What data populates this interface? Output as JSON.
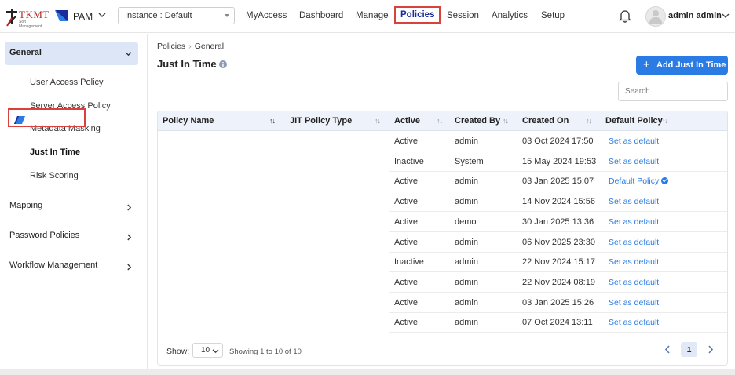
{
  "brand": {
    "logo_text": "TKMT",
    "logo_sub": "Soft Management",
    "product": "PAM"
  },
  "instance": {
    "label": "Instance : Default"
  },
  "nav": {
    "items": [
      {
        "label": "MyAccess"
      },
      {
        "label": "Dashboard"
      },
      {
        "label": "Manage"
      },
      {
        "label": "Policies",
        "active": true
      },
      {
        "label": "Session"
      },
      {
        "label": "Analytics"
      },
      {
        "label": "Setup"
      }
    ]
  },
  "user": {
    "name": "admin admin"
  },
  "sidebar": {
    "general": "General",
    "general_items": [
      "User Access Policy",
      "Server Access Policy",
      "Metadata Masking",
      "Just In Time",
      "Risk Scoring"
    ],
    "groups": [
      "Mapping",
      "Password Policies",
      "Workflow Management"
    ]
  },
  "breadcrumb": {
    "root": "Policies",
    "current": "General"
  },
  "page": {
    "title": "Just In Time",
    "add_label": "Add Just In Time",
    "search_placeholder": "Search"
  },
  "table": {
    "columns": [
      "Policy Name",
      "JIT Policy Type",
      "Active",
      "Created By",
      "Created On",
      "Default Policy"
    ],
    "rows": [
      {
        "active": "Active",
        "created_by": "admin",
        "created_on": "03 Oct 2024 17:50",
        "default": "Set as default"
      },
      {
        "active": "Inactive",
        "created_by": "System",
        "created_on": "15 May 2024 19:53",
        "default": "Set as default"
      },
      {
        "active": "Active",
        "created_by": "admin",
        "created_on": "03 Jan 2025 15:07",
        "default": "Default Policy",
        "is_default": true
      },
      {
        "active": "Active",
        "created_by": "admin",
        "created_on": "14 Nov 2024 15:56",
        "default": "Set as default"
      },
      {
        "active": "Active",
        "created_by": "demo",
        "created_on": "30 Jan 2025 13:36",
        "default": "Set as default"
      },
      {
        "active": "Active",
        "created_by": "admin",
        "created_on": "06 Nov 2025 23:30",
        "default": "Set as default"
      },
      {
        "active": "Inactive",
        "created_by": "admin",
        "created_on": "22 Nov 2024 15:17",
        "default": "Set as default"
      },
      {
        "active": "Active",
        "created_by": "admin",
        "created_on": "22 Nov 2024 08:19",
        "default": "Set as default"
      },
      {
        "active": "Active",
        "created_by": "admin",
        "created_on": "03 Jan 2025 15:26",
        "default": "Set as default"
      },
      {
        "active": "Active",
        "created_by": "admin",
        "created_on": "07 Oct 2024 13:11",
        "default": "Set as default"
      }
    ]
  },
  "footer": {
    "show_label": "Show:",
    "page_size": "10",
    "showing": "Showing 1 to 10 of 10",
    "page": "1"
  },
  "colors": {
    "accent": "#2a7be4",
    "highlight": "#d9423c",
    "sidebar_active_bg": "#dde6f7"
  }
}
